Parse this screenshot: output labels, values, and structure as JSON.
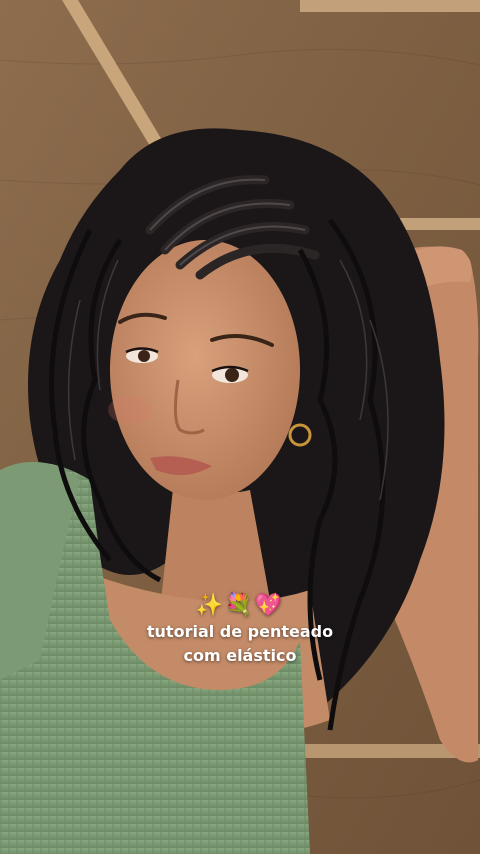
{
  "caption": {
    "emojis": "✨💐💖",
    "line1": "tutorial de penteado",
    "line2": "com elástico"
  },
  "colors": {
    "wood": "#8a6a4a",
    "wood_dark": "#6e5136",
    "trim": "#c9a57c",
    "skin": "#c98f6c",
    "hair": "#1a1718",
    "top": "#7c9b74"
  }
}
